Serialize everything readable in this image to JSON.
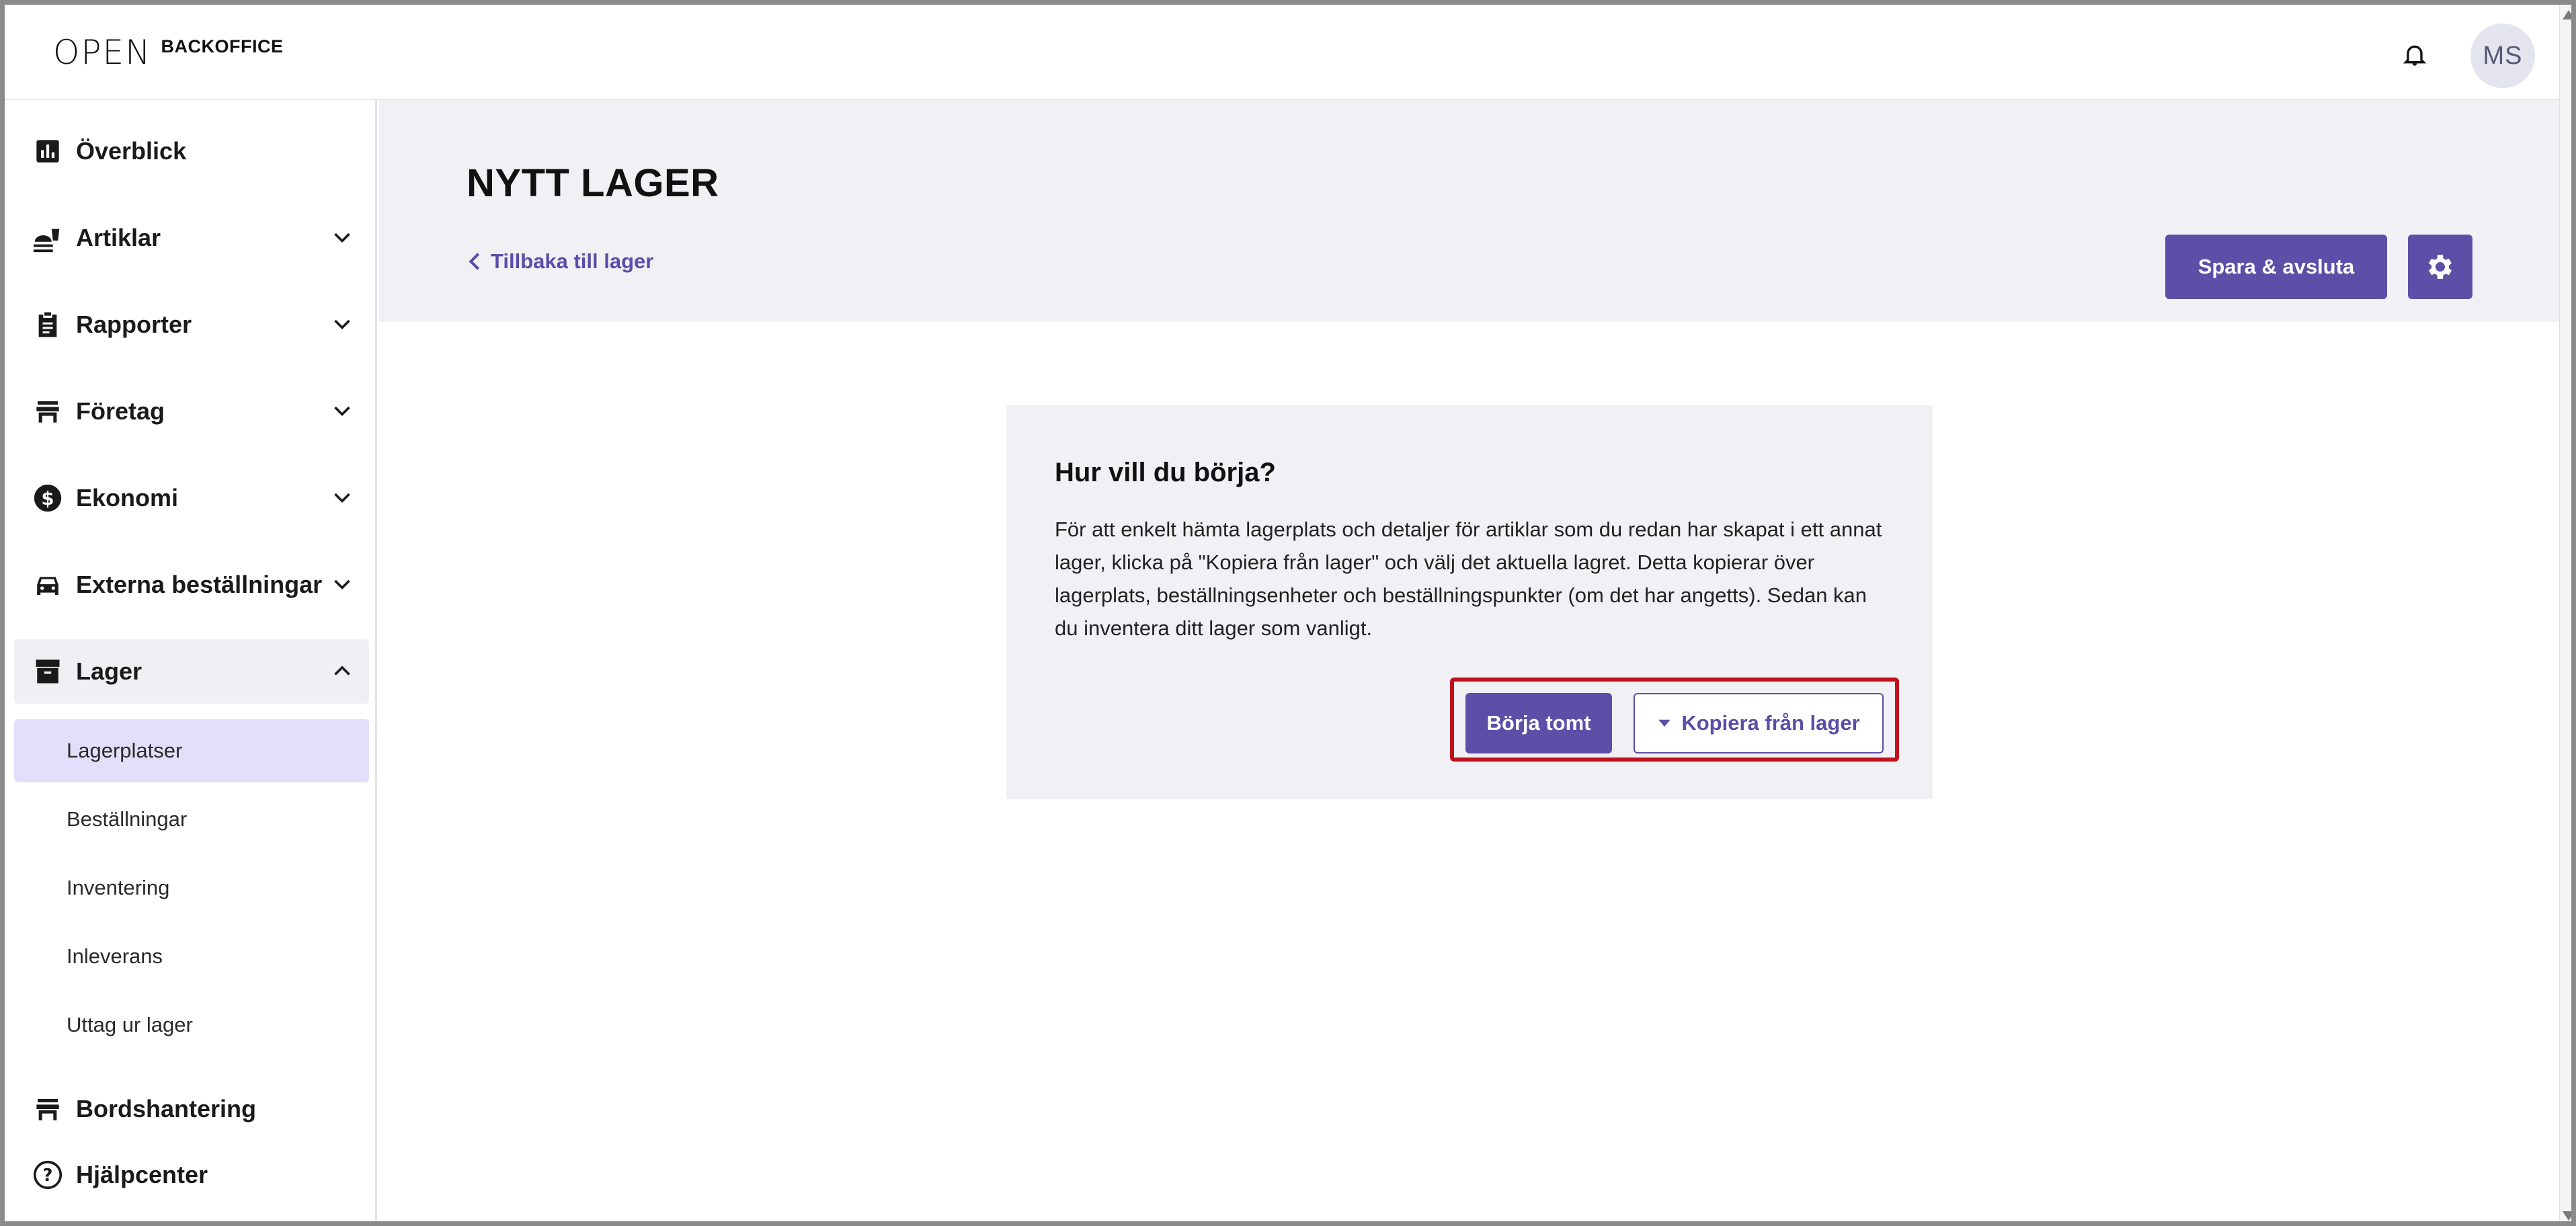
{
  "header": {
    "logo_mark": "OPEN",
    "logo_text": "BACKOFFICE",
    "avatar_initials": "MS"
  },
  "sidebar": {
    "items": [
      {
        "label": "Överblick",
        "icon": "bar-chart-icon"
      },
      {
        "label": "Artiklar",
        "icon": "food-icon"
      },
      {
        "label": "Rapporter",
        "icon": "clipboard-icon"
      },
      {
        "label": "Företag",
        "icon": "store-icon"
      },
      {
        "label": "Ekonomi",
        "icon": "dollar-icon"
      },
      {
        "label": "Externa beställningar",
        "icon": "car-icon"
      },
      {
        "label": "Lager",
        "icon": "archive-icon"
      },
      {
        "label": "Bordshantering",
        "icon": "table-icon"
      },
      {
        "label": "Hjälpcenter",
        "icon": "help-icon"
      }
    ],
    "subitems": [
      {
        "label": "Lagerplatser"
      },
      {
        "label": "Beställningar"
      },
      {
        "label": "Inventering"
      },
      {
        "label": "Inleverans"
      },
      {
        "label": "Uttag ur lager"
      }
    ]
  },
  "page": {
    "title": "NYTT LAGER",
    "back_label": "Tillbaka till lager",
    "save_label": "Spara & avsluta"
  },
  "card": {
    "title": "Hur vill du börja?",
    "text": "För att enkelt hämta lagerplats och detaljer för artiklar som du redan har skapat i ett annat lager, klicka på \"Kopiera från lager\" och välj det aktuella lagret. Detta kopierar över lagerplats, beställningsenheter och beställningspunkter (om det har angetts). Sedan kan du inventera ditt lager som vanligt.",
    "start_label": "Börja tomt",
    "copy_label": "Kopiera från lager"
  },
  "colors": {
    "accent": "#5d4fa8",
    "highlight": "#c0101b",
    "active_bg": "#e2dffa"
  }
}
